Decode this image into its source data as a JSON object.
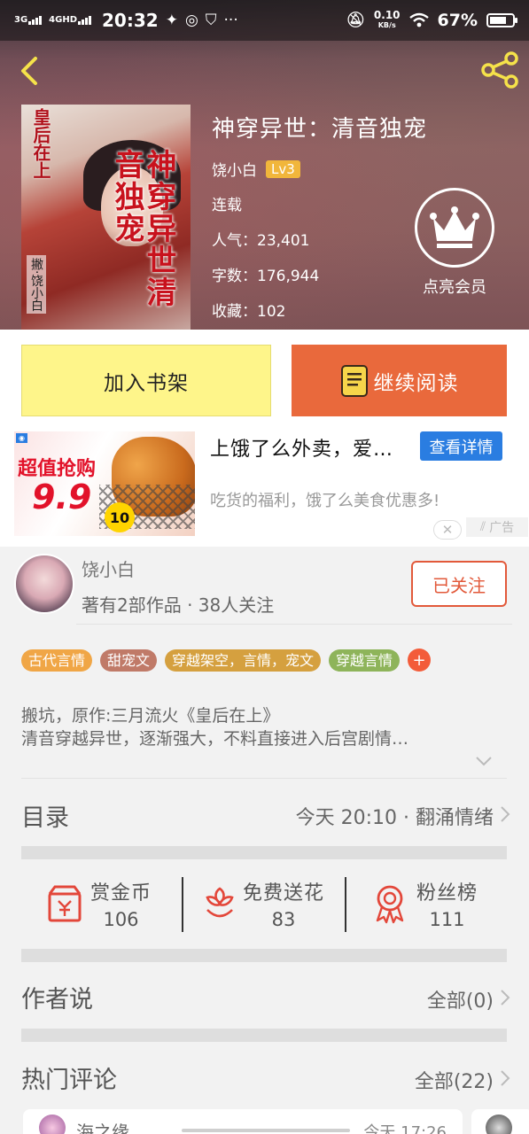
{
  "status_bar": {
    "network1": "3G",
    "network2": "4GHD",
    "time": "20:32",
    "speed": "0.10",
    "speed_unit": "KB/s",
    "battery": "67%"
  },
  "book": {
    "title": "神穿异世：清音独宠",
    "author": "饶小白",
    "author_level": "Lv3",
    "status": "连载",
    "popularity": "人气：23,401",
    "word_count": "字数：176,944",
    "favorites": "收藏：102",
    "cover": {
      "title": "神穿异世清音独宠",
      "subtitle": "皇后在上",
      "author_credit": "撇·饶小白"
    }
  },
  "vip": {
    "label": "点亮会员"
  },
  "actions": {
    "add_shelf": "加入书架",
    "continue_reading": "继续阅读"
  },
  "ad": {
    "title": "上饿了么外卖，爱…",
    "cta": "查看详情",
    "description": "吃货的福利，饿了么美食优惠多!",
    "badge": "广告",
    "image_text1": "超值抢购",
    "image_text2": "9.9",
    "image_badge": "10"
  },
  "author_card": {
    "name": "饶小白",
    "stats": "著有2部作品 · 38人关注",
    "follow": "已关注"
  },
  "tags": [
    {
      "label": "古代言情",
      "color": "#f0a646"
    },
    {
      "label": "甜宠文",
      "color": "#c07a68"
    },
    {
      "label": "穿越架空，言情，宠文",
      "color": "#d5a03f"
    },
    {
      "label": "穿越言情",
      "color": "#8eb45a"
    }
  ],
  "tag_add": "+",
  "description": {
    "line1": "搬坑，原作:三月流火《皇后在上》",
    "line2": "清音穿越异世，逐渐强大，不料直接进入后宫剧情…"
  },
  "toc": {
    "title": "目录",
    "latest": "今天 20:10 · 翻涌情绪"
  },
  "rewards": [
    {
      "label": "赏金币",
      "count": "106",
      "icon": "red-envelope-icon"
    },
    {
      "label": "免费送花",
      "count": "83",
      "icon": "flower-icon"
    },
    {
      "label": "粉丝榜",
      "count": "111",
      "icon": "ribbon-medal-icon"
    }
  ],
  "author_says": {
    "title": "作者说",
    "all": "全部(0)"
  },
  "hot_comments": {
    "title": "热门评论",
    "all": "全部(22)"
  },
  "comment_preview": {
    "name": "海之缘",
    "time": "今天 17:26"
  },
  "colors": {
    "accent": "#e9693c",
    "shelf": "#fef58a",
    "link_blue": "#2a7de1",
    "follow_red": "#e2593a"
  }
}
